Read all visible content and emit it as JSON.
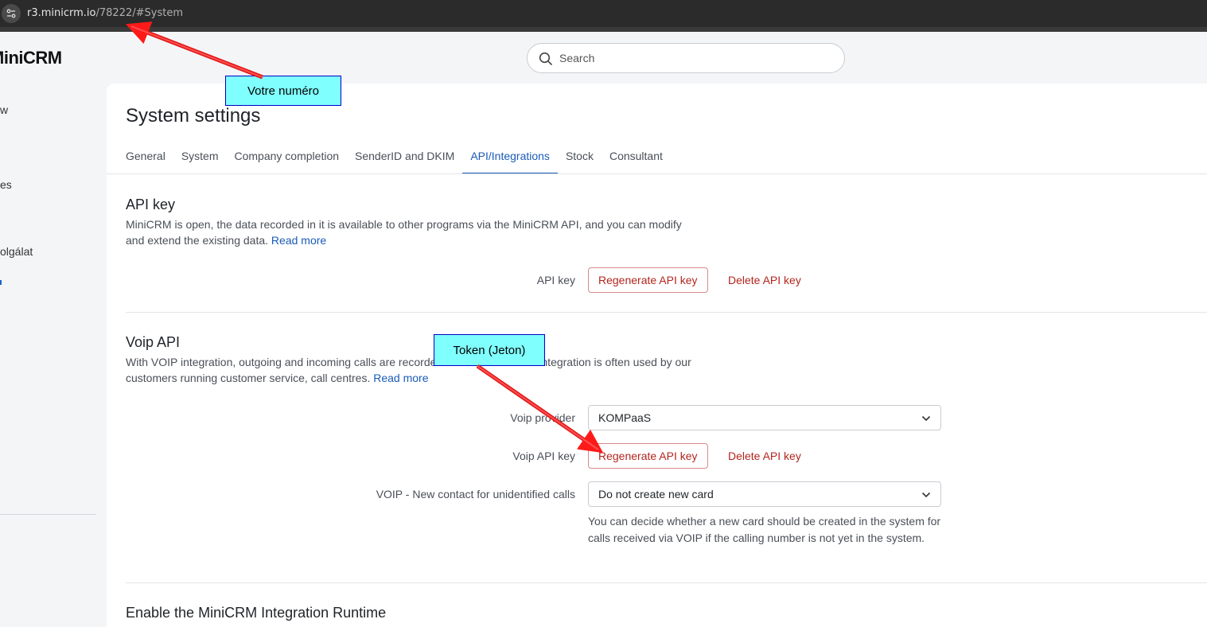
{
  "browser": {
    "url_host": "r3.minicrm.io",
    "url_path": "/78222/#System"
  },
  "app": {
    "logo": "MiniCRM",
    "search_placeholder": "Search"
  },
  "sidebar": {
    "items": [
      {
        "label": "w"
      },
      {
        "label": "es"
      },
      {
        "label": "olgálat"
      }
    ]
  },
  "page": {
    "title": "System settings",
    "tabs": [
      {
        "label": "General",
        "active": false
      },
      {
        "label": "System",
        "active": false
      },
      {
        "label": "Company completion",
        "active": false
      },
      {
        "label": "SenderID and DKIM",
        "active": false
      },
      {
        "label": "API/Integrations",
        "active": true
      },
      {
        "label": "Stock",
        "active": false
      },
      {
        "label": "Consultant",
        "active": false
      }
    ]
  },
  "api_key_section": {
    "title": "API key",
    "desc": "MiniCRM is open, the data recorded in it is available to other programs via the MiniCRM API, and you can modify and extend the existing data.",
    "read_more": "Read more",
    "row_label": "API key",
    "regenerate": "Regenerate API key",
    "delete": "Delete API key"
  },
  "voip_section": {
    "title": "Voip API",
    "desc": "With VOIP integration, outgoing and incoming calls are recorded in MiniCRM. VOIP integration is often used by our customers running customer service, call centres.",
    "read_more": "Read more",
    "provider_label": "Voip provider",
    "provider_value": "KOMPaaS",
    "key_label": "Voip API key",
    "regenerate": "Regenerate API key",
    "delete": "Delete API key",
    "new_contact_label": "VOIP - New contact for unidentified calls",
    "new_contact_value": "Do not create new card",
    "help": "You can decide whether a new card should be created in the system for calls received via VOIP if the calling number is not yet in the system."
  },
  "runtime_section": {
    "title": "Enable the MiniCRM Integration Runtime"
  },
  "annotations": {
    "callout_1": "Votre numéro",
    "callout_2": "Token (Jeton)",
    "callout_bg": "#80ffff",
    "arrow_color": "#ff0000"
  }
}
